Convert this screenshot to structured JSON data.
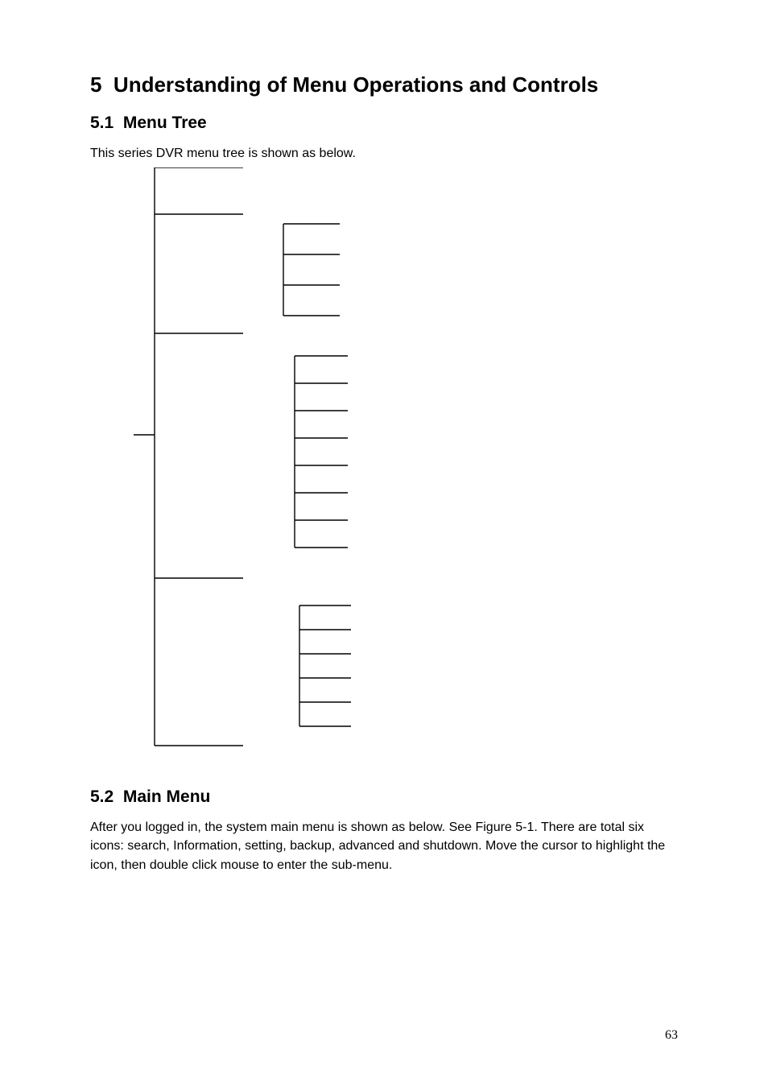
{
  "chapter": {
    "number": "5",
    "title": "Understanding of Menu Operations and Controls"
  },
  "section1": {
    "number": "5.1",
    "title": "Menu Tree",
    "intro": "This series DVR menu tree is shown as below."
  },
  "section2": {
    "number": "5.2",
    "title": "Main Menu",
    "paragraph": "After you logged in, the system main menu is shown as below. See Figure 5-1. There are total six icons: search, Information, setting, backup, advanced and shutdown. Move the cursor to highlight the icon, then double click mouse to enter the sub-menu."
  },
  "page_number": "63",
  "tree": {
    "note": "decorative menu-tree diagram with no visible labels"
  }
}
